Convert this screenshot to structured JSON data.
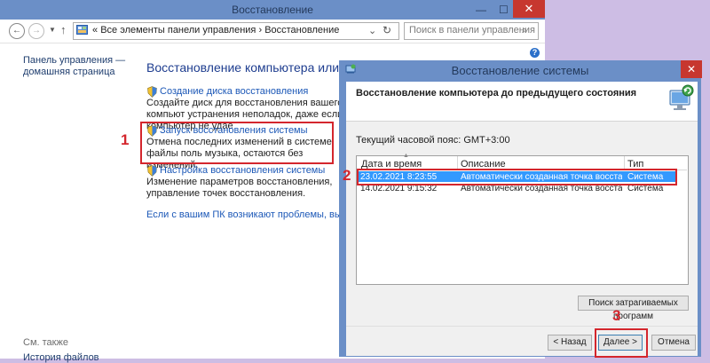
{
  "control_panel": {
    "title": "Восстановление",
    "address_prefix": "«",
    "breadcrumb_root": "Все элементы панели управления",
    "breadcrumb_sep": "›",
    "breadcrumb_current": "Восстановление",
    "search_placeholder": "Поиск в панели управления",
    "sidebar_home": "Панель управления — домашняя страница",
    "see_also": "См. также",
    "sidebar_history": "История файлов",
    "main_heading": "Восстановление компьютера или возврат",
    "items": [
      {
        "link": "Создание диска восстановления",
        "description": "Создайте диск для восстановления вашего компьют устранения неполадок, даже если компьютер не удае"
      },
      {
        "link": "Запуск восстановления системы",
        "description": "Отмена последних изменений в системе; файлы поль музыка, остаются без изменений."
      },
      {
        "link": "Настройка восстановления системы",
        "description": "Изменение параметров восстановления, управление точек восстановления."
      }
    ],
    "trouble_link": "Если с вашим ПК возникают проблемы, вы можете"
  },
  "dialog": {
    "title": "Восстановление системы",
    "heading": "Восстановление компьютера до предыдущего состояния",
    "timezone": "Текущий часовой пояс: GMT+3:00",
    "columns": [
      "Дата и время",
      "Описание",
      "Тип"
    ],
    "rows": [
      {
        "date": "23.02.2021 8:23:55",
        "description": "Автоматически созданная точка восстановле...",
        "type": "Система",
        "selected": true
      },
      {
        "date": "14.02.2021 9:15:32",
        "description": "Автоматически созданная точка восстановле...",
        "type": "Система",
        "selected": false
      }
    ],
    "affected_button": "Поиск затрагиваемых программ",
    "back_button": "< Назад",
    "next_button": "Далее >",
    "cancel_button": "Отмена"
  },
  "annotations": {
    "step1": "1",
    "step2": "2",
    "step3": "3"
  },
  "colors": {
    "titlebar": "#6b8fc7",
    "callout": "#d4262d",
    "selection": "#3399ff",
    "link": "#1c58b7"
  }
}
